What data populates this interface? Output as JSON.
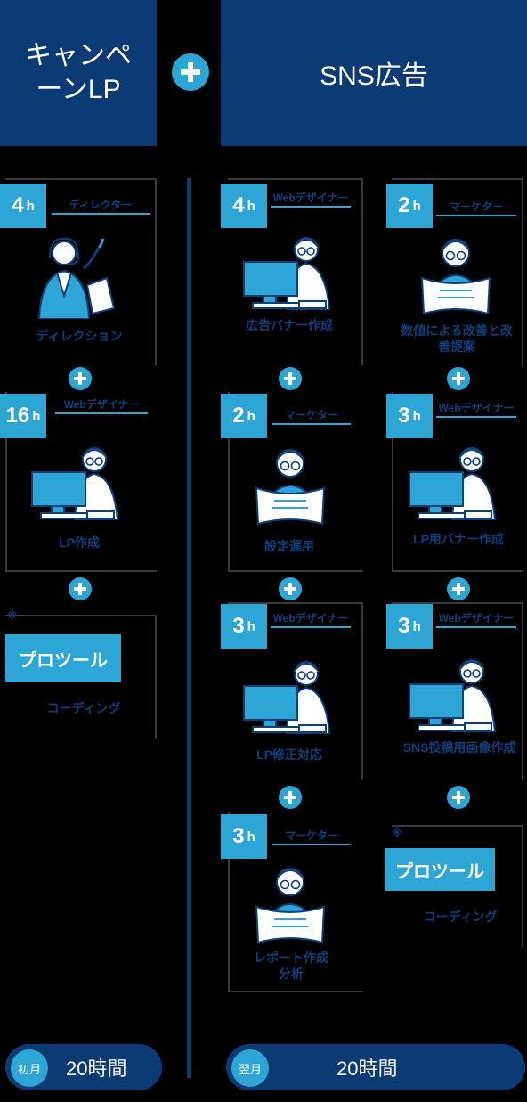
{
  "left": {
    "title": "キャンペーンLP",
    "steps": [
      {
        "hours": "4",
        "unit": "h",
        "role": "ディレクター",
        "task": "ディレクション"
      },
      {
        "hours": "16",
        "unit": "h",
        "role": "Webデザイナー",
        "task": "LP作成"
      }
    ],
    "tool": {
      "mark": "※",
      "name": "プロツール",
      "task": "コーディング"
    },
    "total": {
      "month": "初月",
      "value": "20時間"
    }
  },
  "right": {
    "title": "SNS広告",
    "col1": [
      {
        "hours": "4",
        "unit": "h",
        "role": "Webデザイナー",
        "task": "広告バナー作成"
      },
      {
        "hours": "2",
        "unit": "h",
        "role": "マーケター",
        "task": "設定運用"
      },
      {
        "hours": "3",
        "unit": "h",
        "role": "Webデザイナー",
        "task": "LP修正対応"
      },
      {
        "hours": "3",
        "unit": "h",
        "role": "マーケター",
        "task": "レポート作成分析"
      }
    ],
    "col2": [
      {
        "hours": "2",
        "unit": "h",
        "role": "マーケター",
        "task": "数値による改善と改善提案"
      },
      {
        "hours": "3",
        "unit": "h",
        "role": "Webデザイナー",
        "task": "LP用バナー作成"
      },
      {
        "hours": "3",
        "unit": "h",
        "role": "Webデザイナー",
        "task": "SNS投稿用画像作成"
      }
    ],
    "tool": {
      "mark": "※",
      "name": "プロツール",
      "task": "コーディング"
    },
    "total": {
      "month": "翌月",
      "value": "20時間"
    }
  },
  "icons": [
    "plus-icon",
    "director-icon",
    "designer-icon",
    "marketer-icon"
  ],
  "colors": {
    "navy": "#0c3a74",
    "accent": "#2da6d6",
    "background": "#000000"
  }
}
